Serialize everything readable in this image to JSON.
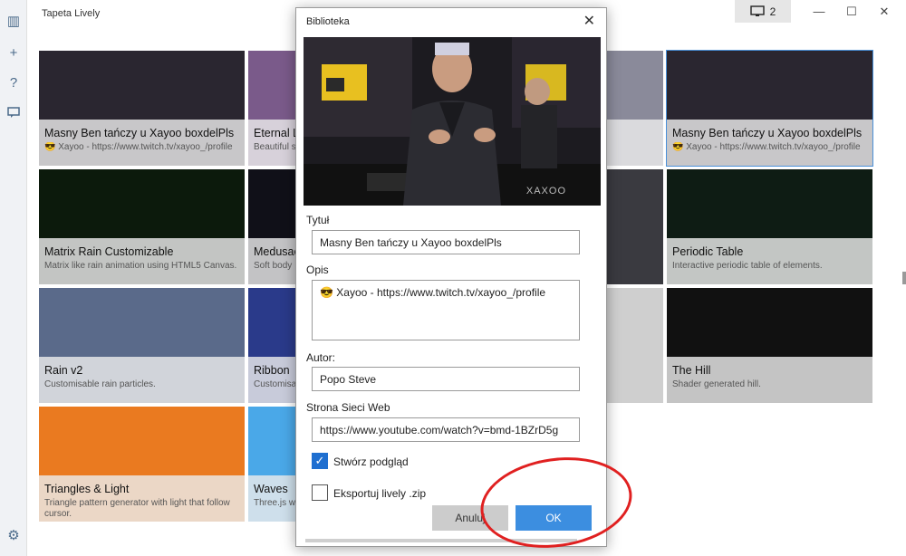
{
  "app": {
    "title": "Tapeta Lively"
  },
  "screen_button": {
    "label": "2",
    "icon": "monitor-icon"
  },
  "rail": [
    {
      "icon": "library-icon",
      "glyph": "▥"
    },
    {
      "icon": "add-icon",
      "glyph": "+"
    },
    {
      "icon": "help-icon",
      "glyph": "?"
    },
    {
      "icon": "feedback-icon",
      "glyph": "▭"
    },
    {
      "icon": "settings-icon",
      "glyph": "⚙"
    }
  ],
  "cards": [
    {
      "title": "Masny Ben tańczy u Xayoo boxdelPls",
      "desc": "😎 Xayoo - https://www.twitch.tv/xayoo_/profile",
      "bg": "#2a2630"
    },
    {
      "title": "Eternal Li",
      "desc": "Beautiful s",
      "bg": "#7a5a8a"
    },
    {
      "title": "",
      "desc": "s with",
      "bg": "#8a8a9a"
    },
    {
      "title": "Masny Ben tańczy u Xayoo boxdelPls",
      "desc": "😎 Xayoo - https://www.twitch.tv/xayoo_/profile",
      "bg": "#2a2630"
    },
    {
      "title": "Matrix Rain Customizable",
      "desc": "Matrix like rain animation using HTML5 Canvas.",
      "bg": "#0c1a0c"
    },
    {
      "title": "Medusae",
      "desc": "Soft body",
      "bg": "#101018"
    },
    {
      "title": "",
      "desc": "",
      "bg": "#3a3a40"
    },
    {
      "title": "Periodic Table",
      "desc": "Interactive periodic table of elements.",
      "bg": "#0e1c14"
    },
    {
      "title": "Rain v2",
      "desc": "Customisable rain particles.",
      "bg": "#5a6a8a"
    },
    {
      "title": "Ribbon",
      "desc": "Customisa",
      "bg": "#2a3a8a"
    },
    {
      "title": "",
      "desc": "",
      "bg": "#cfcfcf"
    },
    {
      "title": "The Hill",
      "desc": "Shader generated hill.",
      "bg": "#111"
    },
    {
      "title": "Triangles & Light",
      "desc": "Triangle pattern generator with light that follow cursor.",
      "bg": "#ea7a20"
    },
    {
      "title": "Waves",
      "desc": "Three.js wa",
      "bg": "#4aa8e8"
    }
  ],
  "dialog": {
    "title": "Biblioteka",
    "title_label": "Tytuł",
    "title_value": "Masny Ben tańczy u Xayoo boxdelPls",
    "desc_label": "Opis",
    "desc_value": "😎 Xayoo - https://www.twitch.tv/xayoo_/profile",
    "author_label": "Autor:",
    "author_value": "Popo Steve",
    "site_label": "Strona Sieci Web",
    "site_value": "https://www.youtube.com/watch?v=bmd-1BZrD5g",
    "preview_check_label": "Stwórz podgląd",
    "preview_checked": true,
    "export_check_label": "Eksportuj lively .zip",
    "export_checked": false,
    "cancel_label": "Anuluj",
    "ok_label": "OK",
    "watermark": "XAXOO"
  }
}
